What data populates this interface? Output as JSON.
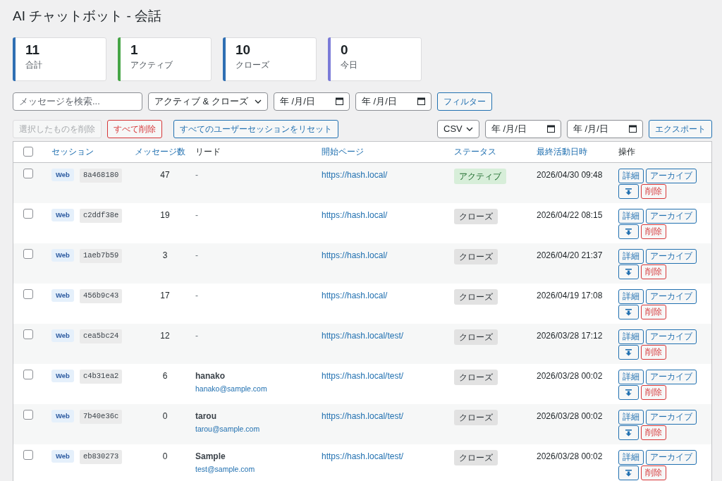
{
  "title": "AI チャットボット - 会話",
  "stats": [
    {
      "value": "11",
      "label": "合計",
      "color": "#2f6fb3"
    },
    {
      "value": "1",
      "label": "アクティブ",
      "color": "#46a546"
    },
    {
      "value": "10",
      "label": "クローズ",
      "color": "#2f6fb3"
    },
    {
      "value": "0",
      "label": "今日",
      "color": "#7b7bd8"
    }
  ],
  "filters": {
    "search_placeholder": "メッセージを検索...",
    "status_select": "アクティブ & クローズ",
    "date_from": "年 /月/日",
    "date_to": "年 /月/日",
    "button": "フィルター"
  },
  "actions_bar": {
    "delete_selected": {
      "label": "選択したものを削除",
      "disabled": true
    },
    "delete_all": "すべて削除",
    "reset_sessions": "すべてのユーザーセッションをリセット",
    "format_select": "CSV",
    "export_from": "年 /月/日",
    "export_to": "年 /月/日",
    "export_button": "エクスポート"
  },
  "table": {
    "select_all_checked": false,
    "columns": [
      {
        "label": "セッション",
        "sortable": true
      },
      {
        "label": "メッセージ数",
        "sortable": true
      },
      {
        "label": "リード",
        "sortable": false
      },
      {
        "label": "開始ページ",
        "sortable": true
      },
      {
        "label": "ステータス",
        "sortable": true
      },
      {
        "label": "最終活動日時",
        "sortable": true
      },
      {
        "label": "操作",
        "sortable": false
      }
    ],
    "rows": [
      {
        "checked": false,
        "channel": "Web",
        "session": "8a468180",
        "messages": "47",
        "lead": {
          "text": "-"
        },
        "start_page": "https://hash.local/",
        "status": {
          "kind": "active",
          "label": "アクティブ"
        },
        "last_activity": "2026/04/30 09:48",
        "actions": [
          "詳細",
          "アーカイブ",
          "削除"
        ]
      },
      {
        "checked": false,
        "channel": "Web",
        "session": "c2ddf38e",
        "messages": "19",
        "lead": {
          "text": "-"
        },
        "start_page": "https://hash.local/",
        "status": {
          "kind": "closed",
          "label": "クローズ"
        },
        "last_activity": "2026/04/22 08:15",
        "actions": [
          "詳細",
          "アーカイブ",
          "削除"
        ]
      },
      {
        "checked": false,
        "channel": "Web",
        "session": "1aeb7b59",
        "messages": "3",
        "lead": {
          "text": "-"
        },
        "start_page": "https://hash.local/",
        "status": {
          "kind": "closed",
          "label": "クローズ"
        },
        "last_activity": "2026/04/20 21:37",
        "actions": [
          "詳細",
          "アーカイブ",
          "削除"
        ]
      },
      {
        "checked": false,
        "channel": "Web",
        "session": "456b9c43",
        "messages": "17",
        "lead": {
          "text": "-"
        },
        "start_page": "https://hash.local/",
        "status": {
          "kind": "closed",
          "label": "クローズ"
        },
        "last_activity": "2026/04/19 17:08",
        "actions": [
          "詳細",
          "アーカイブ",
          "削除"
        ]
      },
      {
        "checked": false,
        "channel": "Web",
        "session": "cea5bc24",
        "messages": "12",
        "lead": {
          "text": "-"
        },
        "start_page": "https://hash.local/test/",
        "status": {
          "kind": "closed",
          "label": "クローズ"
        },
        "last_activity": "2026/03/28 17:12",
        "actions": [
          "詳細",
          "アーカイブ",
          "削除"
        ]
      },
      {
        "checked": false,
        "channel": "Web",
        "session": "c4b31ea2",
        "messages": "6",
        "lead": {
          "name": "hanako",
          "email": "hanako@sample.com"
        },
        "start_page": "https://hash.local/test/",
        "status": {
          "kind": "closed",
          "label": "クローズ"
        },
        "last_activity": "2026/03/28 00:02",
        "actions": [
          "詳細",
          "アーカイブ",
          "削除"
        ]
      },
      {
        "checked": false,
        "channel": "Web",
        "session": "7b40e36c",
        "messages": "0",
        "lead": {
          "name": "tarou",
          "email": "tarou@sample.com"
        },
        "start_page": "https://hash.local/test/",
        "status": {
          "kind": "closed",
          "label": "クローズ"
        },
        "last_activity": "2026/03/28 00:02",
        "actions": [
          "詳細",
          "アーカイブ",
          "削除"
        ]
      },
      {
        "checked": false,
        "channel": "Web",
        "session": "eb830273",
        "messages": "0",
        "lead": {
          "name": "Sample",
          "email": "test@sample.com"
        },
        "start_page": "https://hash.local/test/",
        "status": {
          "kind": "closed",
          "label": "クローズ"
        },
        "last_activity": "2026/03/28 00:02",
        "actions": [
          "詳細",
          "アーカイブ",
          "削除"
        ]
      }
    ]
  }
}
